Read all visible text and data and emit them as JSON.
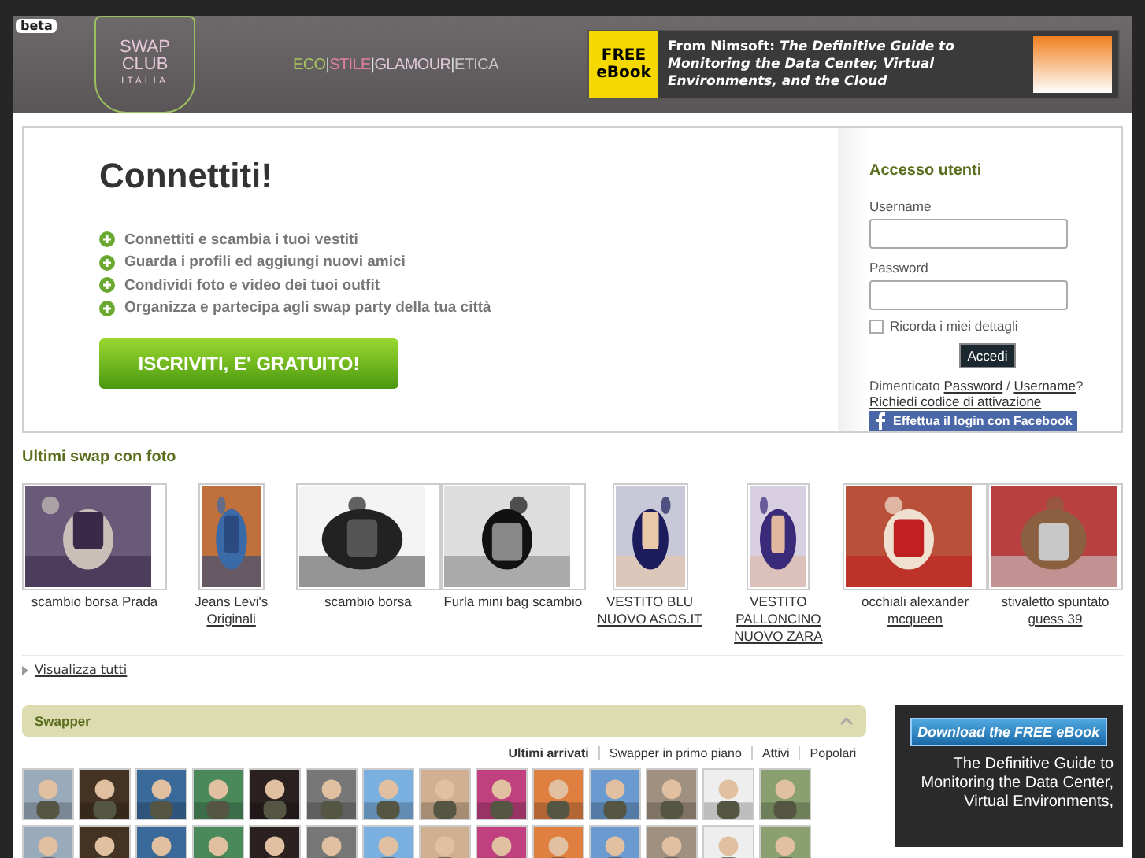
{
  "header": {
    "badge": "beta",
    "logo": [
      "SWAP",
      "CLUB",
      "ITALIA"
    ],
    "tagline": [
      "ECO",
      "|",
      "STILE",
      "|",
      "GLAMOUR",
      "|",
      "ETICA"
    ],
    "ad": {
      "tag": "FREE eBook",
      "text": "From Nimsoft: *The Definitive Guide to Monitoring the Data Center, Virtual Environments, and the Cloud*"
    }
  },
  "intro": {
    "title": "Connettiti!",
    "features": [
      "Connettiti e scambia i tuoi vestiti",
      "Guarda i profili ed aggiungi nuovi amici",
      "Condividi foto e video dei tuoi outfit",
      "Organizza e partecipa agli swap party della tua città"
    ],
    "button": "ISCRIVITI, E' GRATUITO!"
  },
  "login": {
    "title": "Accesso utenti",
    "username_label": "Username",
    "password_label": "Password",
    "remember": {
      "label": "Ricorda i miei dettagli",
      "checked": false
    },
    "submit": "Accedi",
    "forgot": [
      "Dimenticato",
      "Password",
      "/",
      "Username",
      "?"
    ],
    "activation": "Richiedi codice di attivazione",
    "facebook": "Effettua il login con Facebook"
  },
  "swaps": {
    "title": "Ultimi swap con foto",
    "items": [
      {
        "text": "scambio borsa Prada"
      },
      {
        "text": "Jeans Levi's",
        "link": "Originali"
      },
      {
        "text": "scambio borsa"
      },
      {
        "text": "Furla mini bag scambio"
      },
      {
        "text": "VESTITO BLU",
        "link": "NUOVO ASOS.IT"
      },
      {
        "text": "VESTITO",
        "link": "PALLONCINO NUOVO ZARA"
      },
      {
        "text": "occhiali alexander",
        "link": "mcqueen"
      },
      {
        "text": "stivaletto spuntato",
        "link": "guess 39"
      }
    ],
    "more": "Visualizza tutti"
  },
  "swapper": {
    "title": "Swapper",
    "tabs": [
      {
        "label": "Ultimi arrivati",
        "selected": true
      },
      {
        "label": "Swapper in primo piano",
        "selected": false
      },
      {
        "label": "Attivi",
        "selected": false
      },
      {
        "label": "Popolari",
        "selected": false
      }
    ]
  },
  "side_ad": {
    "button": "Download the FREE eBook",
    "text": "The Definitive Guide to Monitoring the Data Center, Virtual Environments,"
  }
}
